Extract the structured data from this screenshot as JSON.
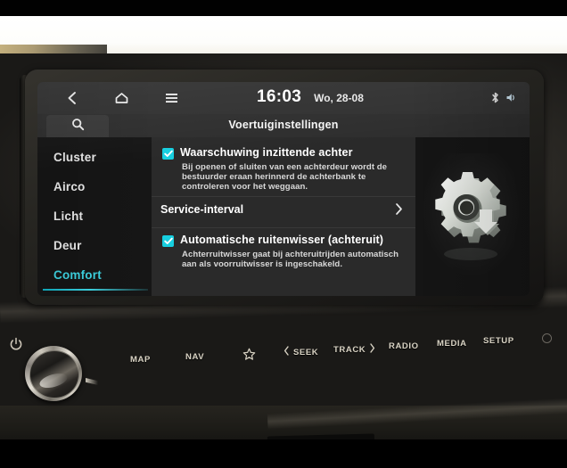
{
  "device": {
    "name": "car-infotainment-head-unit"
  },
  "statusbar": {
    "back_icon": "chevron-left-icon",
    "home_icon": "home-icon",
    "menu_icon": "hamburger-menu-icon",
    "time": "16:03",
    "date": "Wo, 28-08",
    "right_icons": [
      "bluetooth-icon",
      "sound-icon"
    ]
  },
  "titlebar": {
    "search_icon": "search-icon",
    "title": "Voertuiginstellingen"
  },
  "sidebar": {
    "items": [
      {
        "label": "Cluster",
        "selected": false
      },
      {
        "label": "Airco",
        "selected": false
      },
      {
        "label": "Licht",
        "selected": false
      },
      {
        "label": "Deur",
        "selected": false
      },
      {
        "label": "Comfort",
        "selected": true
      }
    ]
  },
  "content": {
    "rows": [
      {
        "type": "checkbox",
        "checked": true,
        "title": "Waarschuwing inzittende achter",
        "description": "Bij openen of sluiten van een achterdeur wordt de bestuurder eraan herinnerd de achterbank te controleren voor het weggaan."
      },
      {
        "type": "link",
        "title": "Service-interval",
        "chevron": "chevron-right-icon"
      },
      {
        "type": "checkbox",
        "checked": true,
        "title": "Automatische ruitenwisser (achteruit)",
        "description": "Achterruitwisser gaat bij achteruitrijden automatisch aan als voorruitwisser is ingeschakeld."
      }
    ]
  },
  "illustration": {
    "icon": "settings-gear-icon"
  },
  "hardware": {
    "power_icon": "power-icon",
    "volume_knob": "volume-knob",
    "buttons": [
      {
        "label": "MAP"
      },
      {
        "label": "NAV"
      },
      {
        "label": "",
        "icon": "star-icon"
      },
      {
        "label": "SEEK",
        "icon_left": "chevron-left-icon"
      },
      {
        "label": "TRACK",
        "icon_right": "chevron-right-icon"
      },
      {
        "label": "RADIO"
      },
      {
        "label": "MEDIA"
      },
      {
        "label": "SETUP"
      }
    ],
    "eject_icon": "eject-dot-icon"
  },
  "colors": {
    "accent_cyan": "#3fd9e8",
    "checkbox_cyan": "#17cfe0",
    "screen_bg": "#1d1d1d",
    "panel_bg": "#2a2a2a",
    "button_text": "#d9d3c4"
  }
}
